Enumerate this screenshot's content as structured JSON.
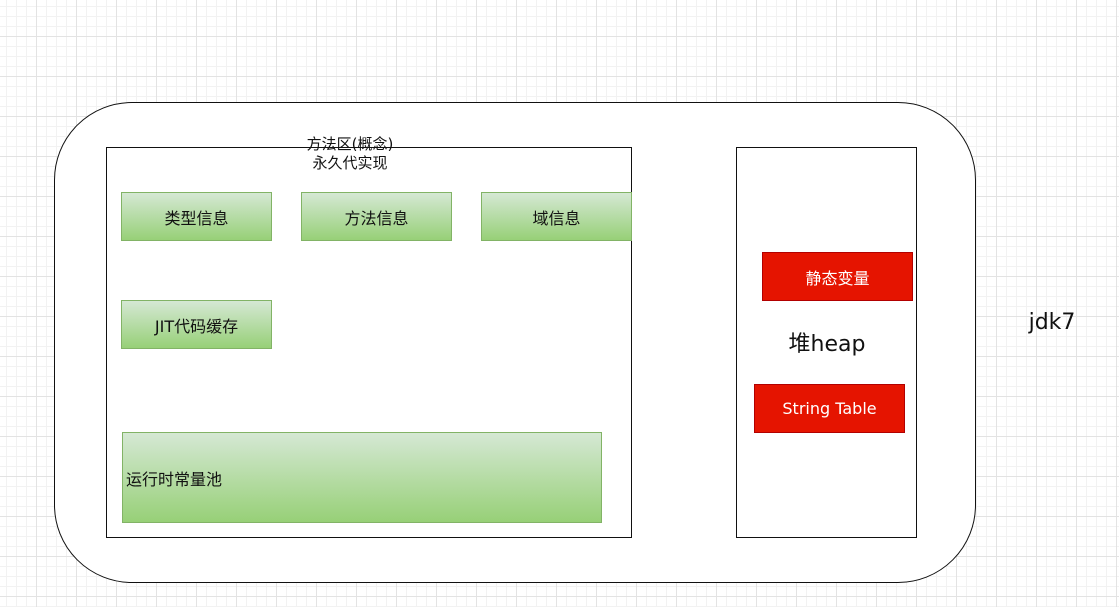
{
  "diagram": {
    "version_label": "jdk7",
    "method_area": {
      "title_line1": "方法区(概念)",
      "title_line2": "永久代实现",
      "items": [
        {
          "label": "类型信息"
        },
        {
          "label": "方法信息"
        },
        {
          "label": "域信息"
        },
        {
          "label": "JIT代码缓存"
        },
        {
          "label": "运行时常量池"
        }
      ]
    },
    "heap": {
      "label": "堆heap",
      "items": [
        {
          "label": "静态变量"
        },
        {
          "label": "String Table"
        }
      ]
    },
    "colors": {
      "green_fill_top": "#d5e8d4",
      "green_fill_bottom": "#97d077",
      "green_stroke": "#82b366",
      "red_fill": "#e51400",
      "red_stroke": "#b20000"
    }
  }
}
